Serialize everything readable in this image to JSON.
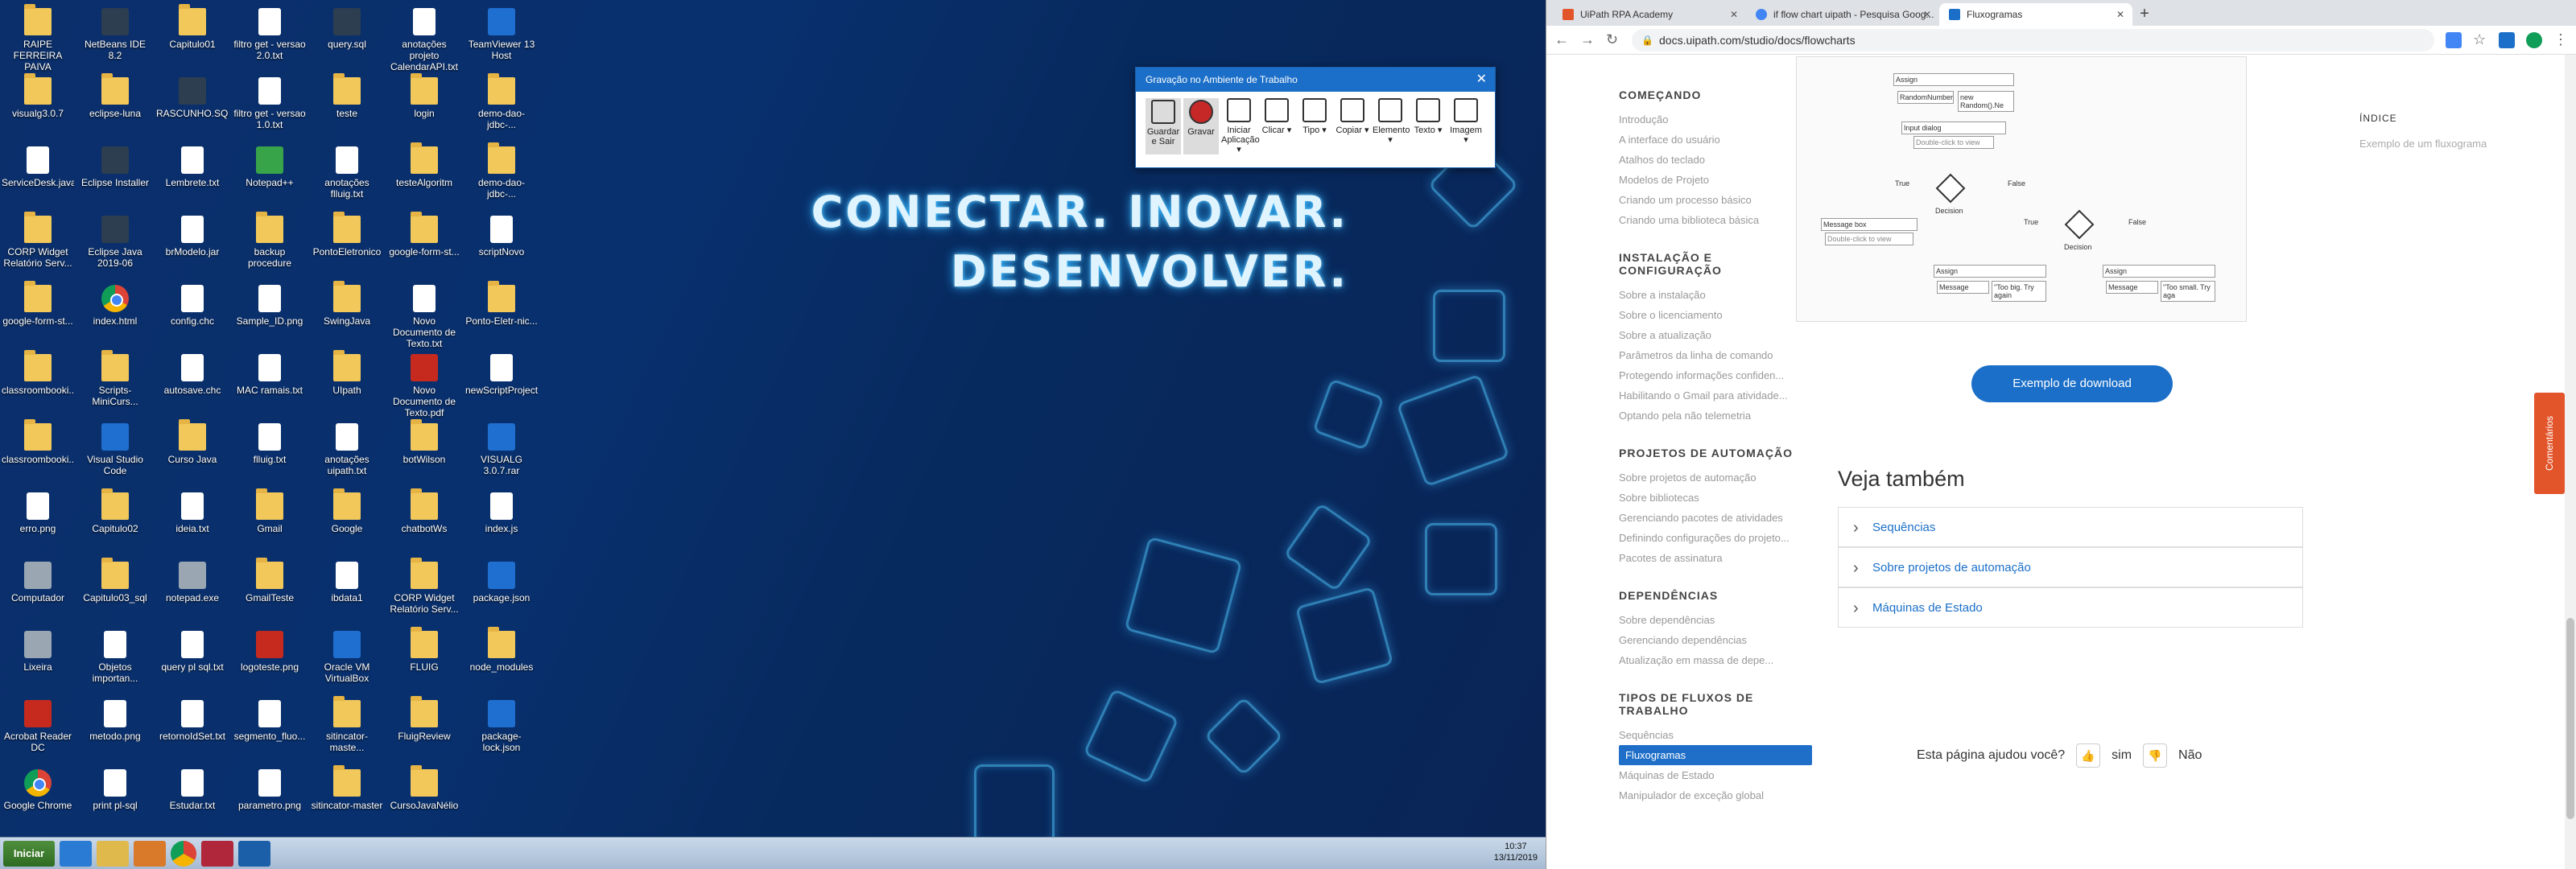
{
  "desktop": {
    "icons": [
      {
        "label": "RAIPE FERREIRA PAIVA",
        "kind": "folder"
      },
      {
        "label": "NetBeans IDE 8.2",
        "kind": "dark"
      },
      {
        "label": "Capitulo01",
        "kind": "folder"
      },
      {
        "label": "filtro get - versao 2.0.txt",
        "kind": "doc"
      },
      {
        "label": "query.sql",
        "kind": "dark"
      },
      {
        "label": "anotações projeto CalendarAPI.txt",
        "kind": "doc"
      },
      {
        "label": "TeamViewer 13 Host",
        "kind": "blue"
      },
      {
        "label": "visualg3.0.7",
        "kind": "folder"
      },
      {
        "label": "eclipse-luna",
        "kind": "folder"
      },
      {
        "label": "RASCUNHO.SQL",
        "kind": "dark"
      },
      {
        "label": "filtro get - versao 1.0.txt",
        "kind": "doc"
      },
      {
        "label": "teste",
        "kind": "folder"
      },
      {
        "label": "login",
        "kind": "folder"
      },
      {
        "label": "demo-dao-jdbc-...",
        "kind": "folder"
      },
      {
        "label": "ServiceDesk.java",
        "kind": "doc"
      },
      {
        "label": "Eclipse Installer",
        "kind": "dark"
      },
      {
        "label": "Lembrete.txt",
        "kind": "doc"
      },
      {
        "label": "Notepad++",
        "kind": "green"
      },
      {
        "label": "anotações flluig.txt",
        "kind": "doc"
      },
      {
        "label": "testeAlgoritm",
        "kind": "folder"
      },
      {
        "label": "demo-dao-jdbc-...",
        "kind": "folder"
      },
      {
        "label": "CORP Widget Relatório Serv...",
        "kind": "folder"
      },
      {
        "label": "Eclipse Java 2019-06",
        "kind": "dark"
      },
      {
        "label": "brModelo.jar",
        "kind": "doc"
      },
      {
        "label": "backup procedure",
        "kind": "folder"
      },
      {
        "label": "PontoEletronico",
        "kind": "folder"
      },
      {
        "label": "google-form-st...",
        "kind": "folder"
      },
      {
        "label": "scriptNovo",
        "kind": "doc"
      },
      {
        "label": "google-form-st...",
        "kind": "folder"
      },
      {
        "label": "index.html",
        "kind": "chrome"
      },
      {
        "label": "config.chc",
        "kind": "doc"
      },
      {
        "label": "Sample_ID.png",
        "kind": "doc"
      },
      {
        "label": "SwingJava",
        "kind": "folder"
      },
      {
        "label": "Novo Documento de Texto.txt",
        "kind": "doc"
      },
      {
        "label": "Ponto-Eletr-nic...",
        "kind": "folder"
      },
      {
        "label": "classroombooki...",
        "kind": "folder"
      },
      {
        "label": "Scripts-MiniCurs...",
        "kind": "folder"
      },
      {
        "label": "autosave.chc",
        "kind": "doc"
      },
      {
        "label": "MAC ramais.txt",
        "kind": "doc"
      },
      {
        "label": "UIpath",
        "kind": "folder"
      },
      {
        "label": "Novo Documento de Texto.pdf",
        "kind": "red"
      },
      {
        "label": "newScriptProject",
        "kind": "doc"
      },
      {
        "label": "classroombooki...",
        "kind": "folder"
      },
      {
        "label": "Visual Studio Code",
        "kind": "blue"
      },
      {
        "label": "Curso Java",
        "kind": "folder"
      },
      {
        "label": "flluig.txt",
        "kind": "doc"
      },
      {
        "label": "anotações uipath.txt",
        "kind": "doc"
      },
      {
        "label": "botWilson",
        "kind": "folder"
      },
      {
        "label": "VISUALG 3.0.7.rar",
        "kind": "blue"
      },
      {
        "label": "erro.png",
        "kind": "doc"
      },
      {
        "label": "Capitulo02",
        "kind": "folder"
      },
      {
        "label": "ideia.txt",
        "kind": "doc"
      },
      {
        "label": "Gmail",
        "kind": "folder"
      },
      {
        "label": "Google",
        "kind": "folder"
      },
      {
        "label": "chatbotWs",
        "kind": "folder"
      },
      {
        "label": "index.js",
        "kind": "doc"
      },
      {
        "label": "Computador",
        "kind": "gray"
      },
      {
        "label": "Capitulo03_sql",
        "kind": "folder"
      },
      {
        "label": "notepad.exe",
        "kind": "gray"
      },
      {
        "label": "GmailTeste",
        "kind": "folder"
      },
      {
        "label": "ibdata1",
        "kind": "doc"
      },
      {
        "label": "CORP Widget Relatório Serv...",
        "kind": "folder"
      },
      {
        "label": "package.json",
        "kind": "blue"
      },
      {
        "label": "Lixeira",
        "kind": "gray"
      },
      {
        "label": "Objetos importan...",
        "kind": "doc"
      },
      {
        "label": "query pl sql.txt",
        "kind": "doc"
      },
      {
        "label": "logoteste.png",
        "kind": "red"
      },
      {
        "label": "Oracle VM VirtualBox",
        "kind": "blue"
      },
      {
        "label": "FLUIG",
        "kind": "folder"
      },
      {
        "label": "node_modules",
        "kind": "folder"
      },
      {
        "label": "Acrobat Reader DC",
        "kind": "red"
      },
      {
        "label": "metodo.png",
        "kind": "doc"
      },
      {
        "label": "retornoIdSet.txt",
        "kind": "doc"
      },
      {
        "label": "segmento_fluo...",
        "kind": "doc"
      },
      {
        "label": "sitincator-maste...",
        "kind": "folder"
      },
      {
        "label": "FluigReview",
        "kind": "folder"
      },
      {
        "label": "package-lock.json",
        "kind": "blue"
      },
      {
        "label": "Google Chrome",
        "kind": "chrome"
      },
      {
        "label": "print pl-sql",
        "kind": "doc"
      },
      {
        "label": "Estudar.txt",
        "kind": "doc"
      },
      {
        "label": "parametro.png",
        "kind": "doc"
      },
      {
        "label": "sitincator-master",
        "kind": "folder"
      },
      {
        "label": "CursoJavaNélio",
        "kind": "folder"
      }
    ],
    "slogan_line1": "CONECTAR. INOVAR.",
    "slogan_line2": "DESENVOLVER."
  },
  "recorder": {
    "title": "Gravação no Ambiente de Trabalho",
    "tools": [
      "Guardar e Sair",
      "Gravar",
      "Iniciar Aplicação ▾",
      "Clicar ▾",
      "Tipo ▾",
      "Copiar ▾",
      "Elemento ▾",
      "Texto ▾",
      "Imagem ▾"
    ]
  },
  "taskbar": {
    "start": "Iniciar",
    "time": "10:37",
    "date": "13/11/2019"
  },
  "browser": {
    "tabs": [
      {
        "label": "UiPath RPA Academy"
      },
      {
        "label": "if flow chart uipath - Pesquisa Goog..."
      },
      {
        "label": "Fluxogramas"
      }
    ],
    "url": "docs.uipath.com/studio/docs/flowcharts",
    "sidebar": [
      {
        "title": "COMEÇANDO",
        "items": [
          "Introdução",
          "A interface do usuário",
          "Atalhos do teclado",
          "Modelos de Projeto",
          "Criando um processo básico",
          "Criando uma biblioteca básica"
        ]
      },
      {
        "title": "INSTALAÇÃO E CONFIGURAÇÃO",
        "items": [
          "Sobre a instalação",
          "Sobre o licenciamento",
          "Sobre a atualização",
          "Parâmetros da linha de comando",
          "Protegendo informações confiden...",
          "Habilitando o Gmail para atividade...",
          "Optando pela não telemetria"
        ]
      },
      {
        "title": "PROJETOS DE AUTOMAÇÃO",
        "items": [
          "Sobre projetos de automação",
          "Sobre bibliotecas",
          "Gerenciando pacotes de atividades",
          "Definindo configurações do projeto...",
          "Pacotes de assinatura"
        ]
      },
      {
        "title": "DEPENDÊNCIAS",
        "items": [
          "Sobre dependências",
          "Gerenciando dependências",
          "Atualização em massa de depe..."
        ]
      },
      {
        "title": "TIPOS DE FLUXOS DE TRABALHO",
        "items": [
          "Sequências",
          "Fluxogramas",
          "Máquinas de Estado",
          "Manipulador de exceção global"
        ]
      }
    ],
    "active_item": "Fluxogramas",
    "diagram": {
      "nodes": [
        "Assign",
        "RandomNumber",
        "new Random().Ne",
        "Input dialog",
        "Double-click to view",
        "Decision",
        "True",
        "False",
        "Message box",
        "Double-click to view",
        "Decision",
        "True",
        "False",
        "Assign",
        "Message",
        "\"Too big. Try again",
        "Assign",
        "Message",
        "\"Too small. Try aga"
      ]
    },
    "download_button": "Exemplo de download",
    "see_also_title": "Veja também",
    "see_also": [
      "Sequências",
      "Sobre projetos de automação",
      "Máquinas de Estado"
    ],
    "helpful_question": "Esta página ajudou você?",
    "yes": "sim",
    "no": "Não",
    "toc_heading": "ÍNDICE",
    "toc_link": "Exemplo de um fluxograma",
    "feedback": "Comentários"
  }
}
